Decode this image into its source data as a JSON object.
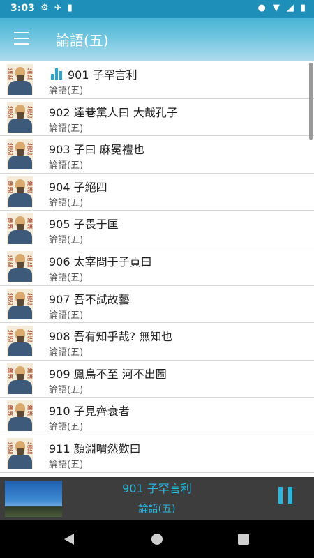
{
  "status_bar": {
    "time": "3:03",
    "left_icons": [
      "gear-icon",
      "airplane-icon",
      "sd-card-icon"
    ],
    "right_icons": [
      "location-icon",
      "wifi-icon",
      "signal-icon",
      "battery-icon"
    ]
  },
  "app_bar": {
    "title": "論語(五)",
    "menu_icon": "hamburger-menu-icon"
  },
  "thumbnail_text": {
    "left": "論語",
    "right": "論語"
  },
  "playing_indicator_icon": "equalizer-icon",
  "tracks": [
    {
      "title": "901 子罕言利",
      "subtitle": "論語(五)",
      "playing": true
    },
    {
      "title": "902 達巷黨人曰 大哉孔子",
      "subtitle": "論語(五)",
      "playing": false
    },
    {
      "title": "903 子曰 麻冕禮也",
      "subtitle": "論語(五)",
      "playing": false
    },
    {
      "title": "904 子絕四",
      "subtitle": "論語(五)",
      "playing": false
    },
    {
      "title": "905 子畏于匡",
      "subtitle": "論語(五)",
      "playing": false
    },
    {
      "title": "906 太宰問于子貢曰",
      "subtitle": "論語(五)",
      "playing": false
    },
    {
      "title": "907 吾不試故藝",
      "subtitle": "論語(五)",
      "playing": false
    },
    {
      "title": "908 吾有知乎哉? 無知也",
      "subtitle": "論語(五)",
      "playing": false
    },
    {
      "title": "909 鳳鳥不至 河不出圖",
      "subtitle": "論語(五)",
      "playing": false
    },
    {
      "title": "910 子見齊衰者",
      "subtitle": "論語(五)",
      "playing": false
    },
    {
      "title": "911 顏淵喟然歎曰",
      "subtitle": "論語(五)",
      "playing": false
    }
  ],
  "player": {
    "title": "901 子罕言利",
    "subtitle": "論語(五)",
    "pause_icon": "pause-icon",
    "accent_color": "#2ab7e0"
  },
  "nav_bar": {
    "back_icon": "back-icon",
    "home_icon": "home-icon",
    "recents_icon": "recents-icon"
  }
}
